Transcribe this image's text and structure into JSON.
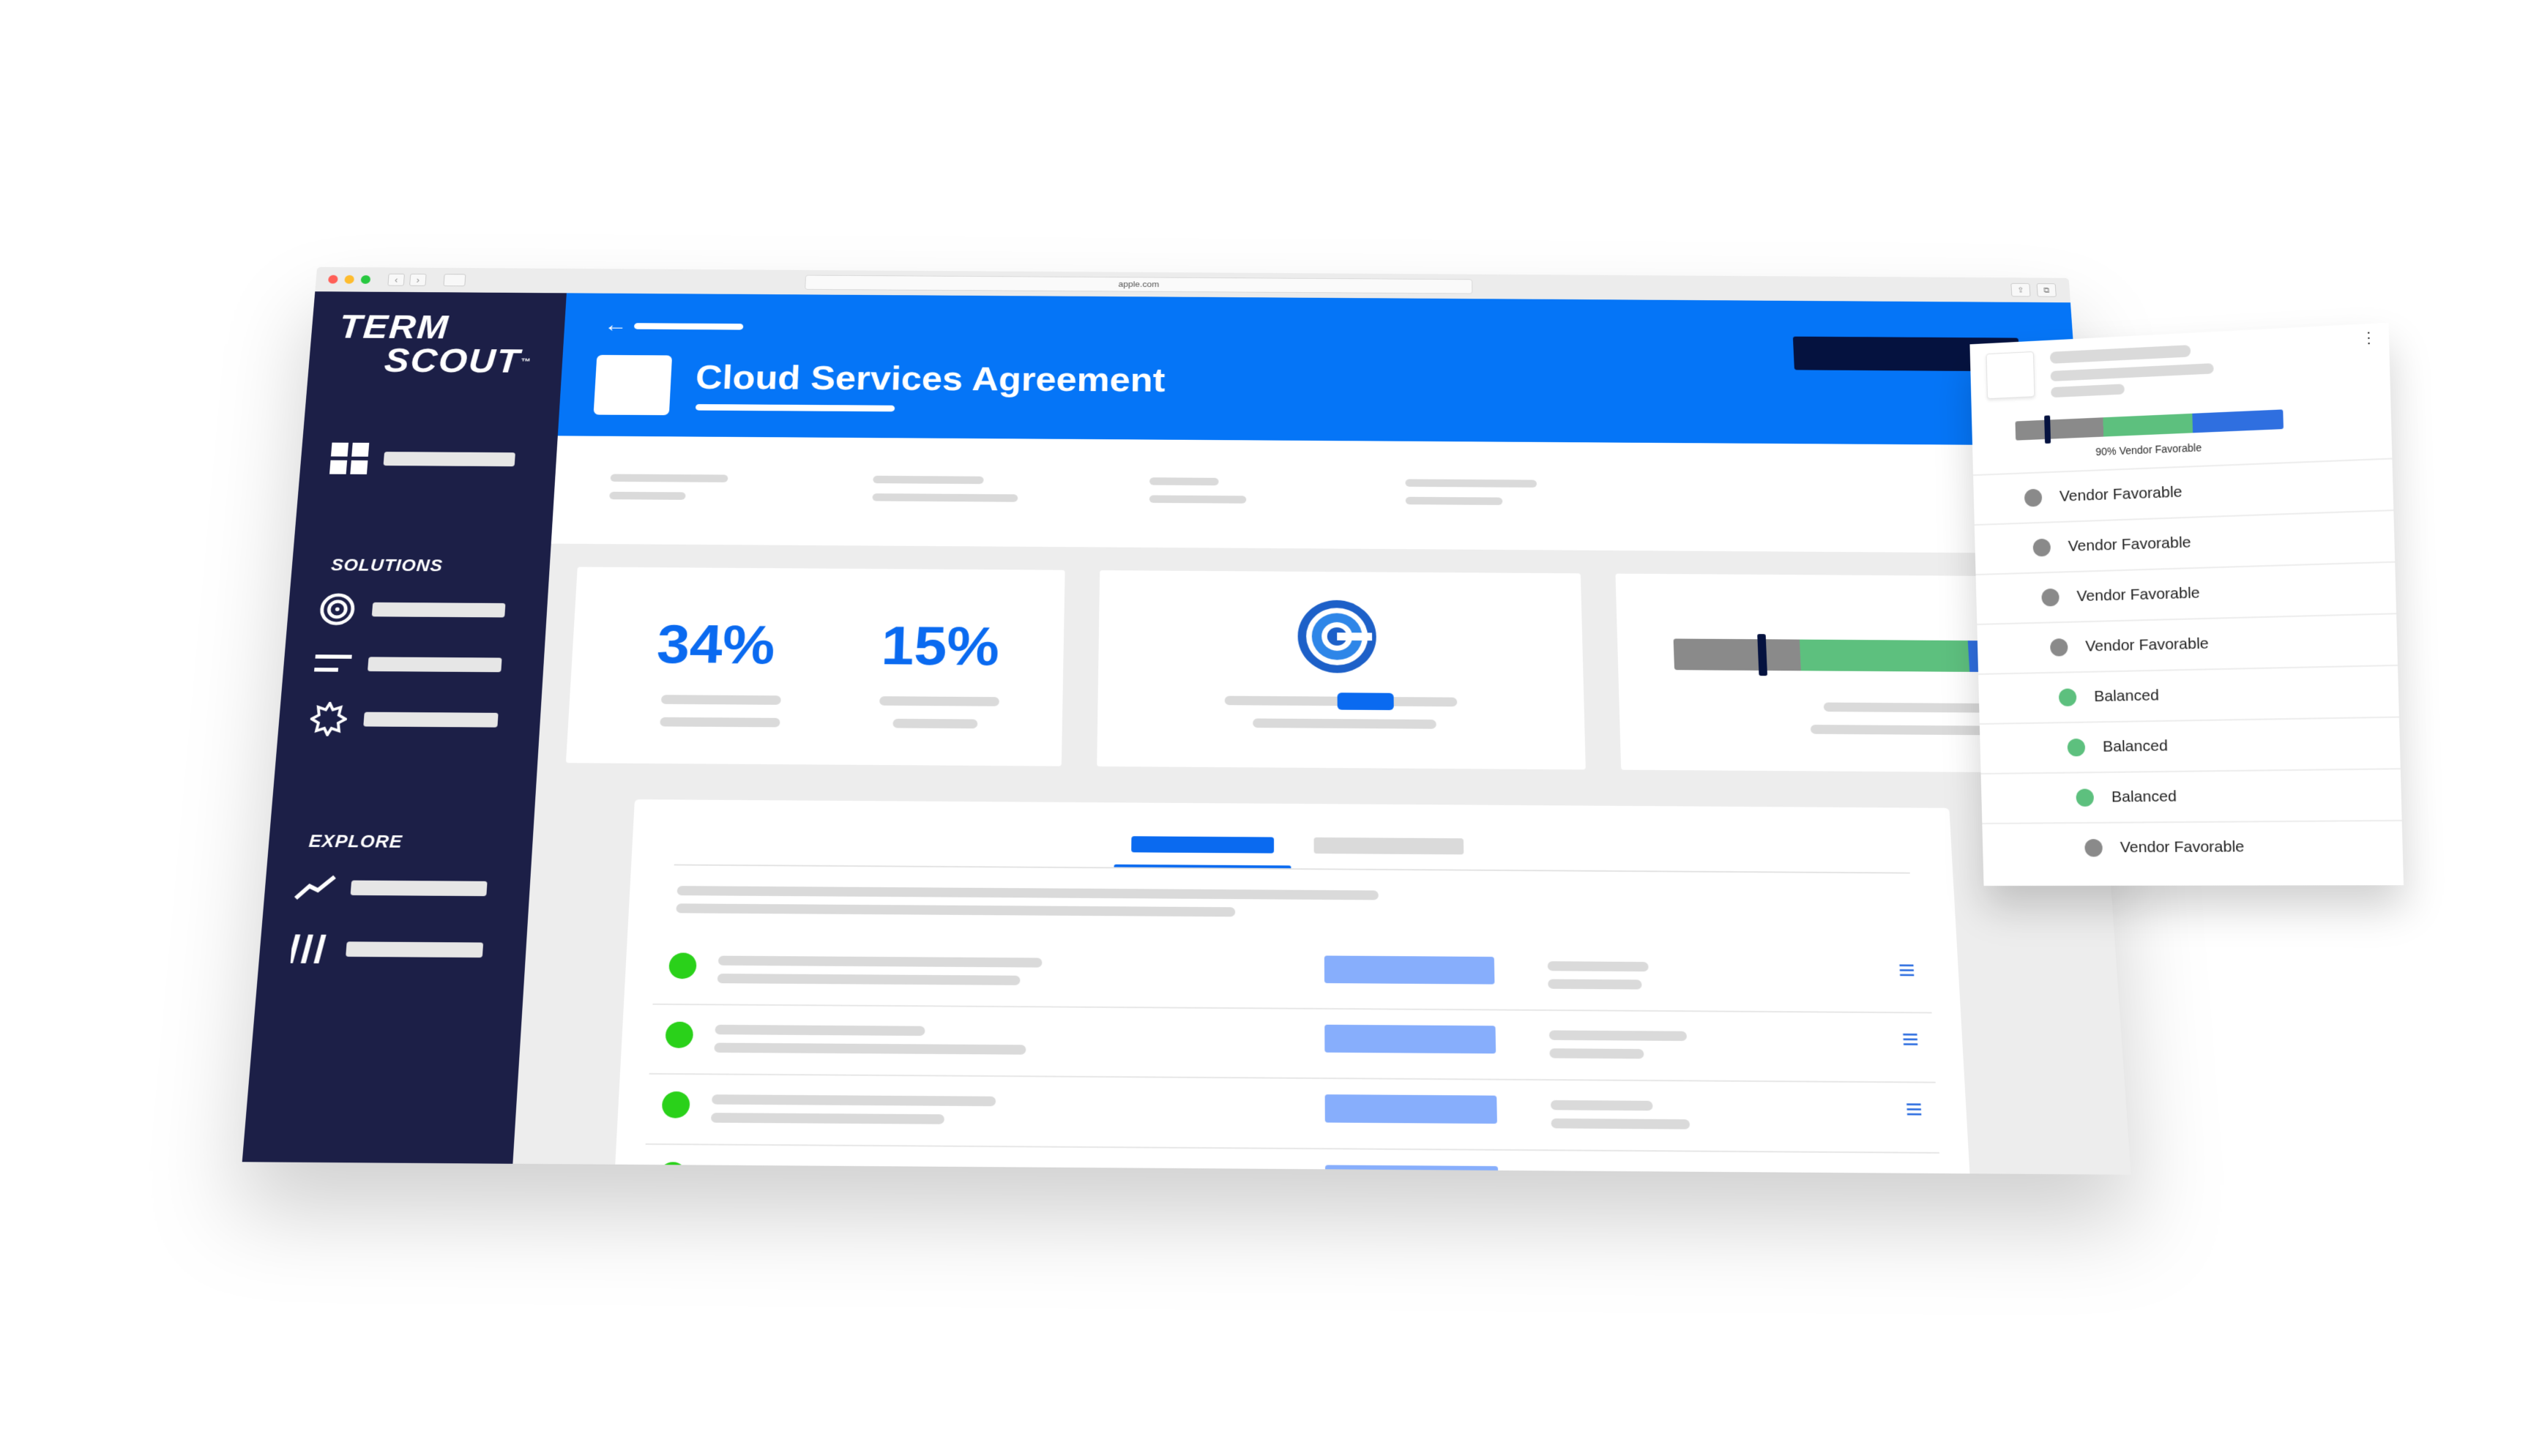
{
  "browser": {
    "url": "apple.com",
    "nav_back": "‹",
    "nav_forward": "›"
  },
  "brand": {
    "logo_line1": "TERM",
    "logo_line2": "SCOUT",
    "logo_tm": "™"
  },
  "sidebar": {
    "solutions_heading": "SOLUTIONS",
    "explore_heading": "EXPLORE"
  },
  "header": {
    "back_icon": "←",
    "title": "Cloud Services Agreement"
  },
  "stats": {
    "stat1": "34%",
    "stat2": "15%"
  },
  "favorability_panel": {
    "caption": "90% Vendor Favorable",
    "marker_position_percent": 10,
    "items": [
      {
        "label": "Vendor Favorable",
        "status": "vendor"
      },
      {
        "label": "Vendor Favorable",
        "status": "vendor"
      },
      {
        "label": "Vendor Favorable",
        "status": "vendor"
      },
      {
        "label": "Vendor Favorable",
        "status": "vendor"
      },
      {
        "label": "Balanced",
        "status": "balanced"
      },
      {
        "label": "Balanced",
        "status": "balanced"
      },
      {
        "label": "Balanced",
        "status": "balanced"
      },
      {
        "label": "Vendor Favorable",
        "status": "vendor"
      }
    ]
  },
  "colors": {
    "brand_blue": "#0575f7",
    "sidebar_navy": "#1c1f47",
    "vendor_gray": "#8a8a8a",
    "balanced_green": "#5dc07e",
    "customer_blue": "#2f6fe0",
    "ok_green": "#2ad11a"
  },
  "icons": {
    "dashboard": "grid-icon",
    "target": "target-icon",
    "lines": "lines-icon",
    "badge": "badge-icon",
    "trend": "trend-icon",
    "bars": "bars-icon",
    "menu": "hamburger-icon",
    "kebab": "kebab-icon"
  }
}
